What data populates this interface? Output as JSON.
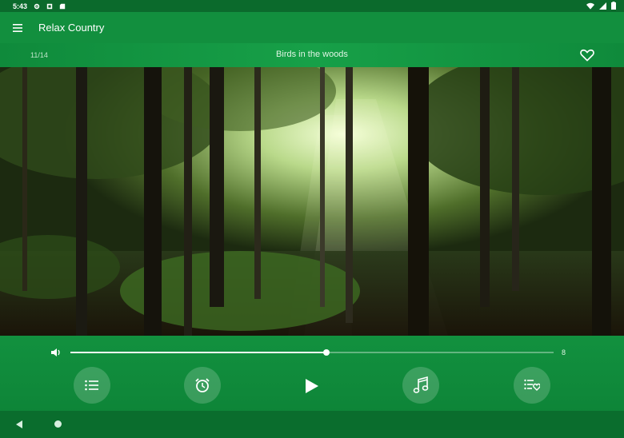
{
  "status": {
    "time": "5:43",
    "left_icons": [
      "gear-icon",
      "notification-icon",
      "sd-card-icon"
    ],
    "right_icons": [
      "wifi-icon",
      "signal-icon",
      "battery-icon"
    ]
  },
  "app": {
    "title": "Relax Country",
    "menu_icon": "hamburger-menu-icon"
  },
  "track": {
    "index": "11/14",
    "title": "Birds in the woods",
    "favorite_icon": "heart-outline-icon"
  },
  "volume": {
    "icon": "speaker-icon",
    "level_fraction": 0.53,
    "value": "8"
  },
  "controls": [
    {
      "name": "playlist-button",
      "icon": "list-icon"
    },
    {
      "name": "timer-button",
      "icon": "alarm-clock-icon"
    },
    {
      "name": "play-button",
      "icon": "play-icon"
    },
    {
      "name": "music-button",
      "icon": "music-note-icon"
    },
    {
      "name": "favorites-list-button",
      "icon": "list-heart-icon"
    }
  ],
  "colors": {
    "primary": "#128f3e",
    "dark": "#0b6a2c",
    "accent": "#ffffff"
  }
}
